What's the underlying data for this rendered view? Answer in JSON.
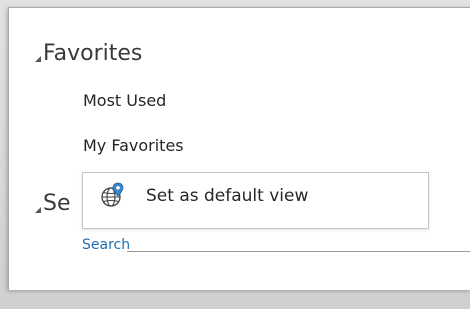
{
  "favorites": {
    "title": "Favorites",
    "items": [
      {
        "label": "Most Used"
      },
      {
        "label": "My Favorites"
      }
    ]
  },
  "second_section": {
    "title_visible": "Se"
  },
  "context_menu": {
    "item_label": "Set as default view",
    "icon": "globe-pin-icon"
  },
  "search": {
    "label": "Search"
  },
  "colors": {
    "link": "#1f6fb4",
    "text": "#262626",
    "heading": "#3a3a3a"
  }
}
